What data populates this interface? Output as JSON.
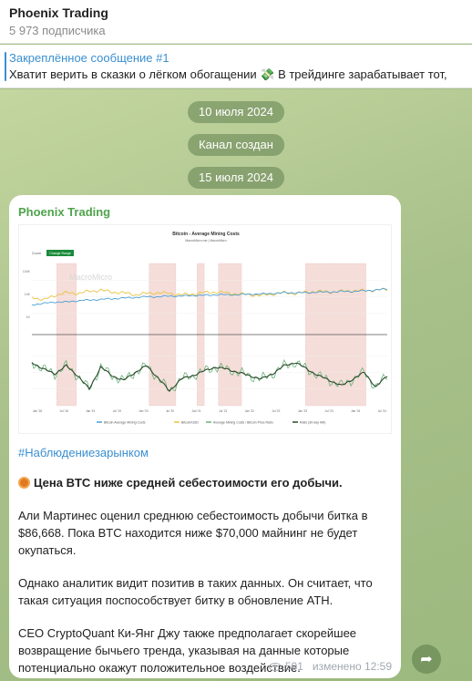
{
  "channel": {
    "title": "Phoenix Trading",
    "subscribers": "5 973 подписчика"
  },
  "pinned": {
    "title": "Закреплённое сообщение #1",
    "text": "Хватит верить в сказки о лёгком обогащении 💸 В трейдинге зарабатывает тот,"
  },
  "service": {
    "date1": "10 июля 2024",
    "created": "Канал создан",
    "date2": "15 июля 2024"
  },
  "message": {
    "author": "Phoenix Trading",
    "hashtag": "#Наблюдениезарынком",
    "headline": "Цена BTC ниже средней себестоимости его добычи.",
    "para1": [
      "Али Мартинес оценил среднюю себестоимость добычи битка в",
      "$86,668. Пока BTC находится ниже $70,000 майнинг не будет",
      "окупаться."
    ],
    "para2": [
      "Однако аналитик видит позитив в таких данных. Он считает, что",
      "такая ситуация поспособствует битку в обновление ATH."
    ],
    "para3": [
      "CEO CryptoQuant Ки-Янг Джу также предполагает скорейшее",
      "возвращение бычьего тренда, указывая на данные которые",
      "потенциально окажут положительное воздействие."
    ],
    "views": "501",
    "edited": "изменено 12:59"
  },
  "chart_data": {
    "type": "line",
    "title": "Bitcoin - Average Mining Costs",
    "subtitle": "MacroMicro.me | MacroMicro",
    "zoom_label": "Zoom",
    "zoom_button": "Change Range",
    "watermark": "MacroMicro",
    "x_ticks": [
      "Jan '18",
      "Jul '18",
      "Jan '19",
      "Jul '19",
      "Jan '20",
      "Jul '20",
      "Jan '21",
      "Jul '21",
      "Jan '22",
      "Jul '22",
      "Jan '23",
      "Jul '23",
      "Jan '24",
      "Jul '24"
    ],
    "upper_y_ticks": [
      "100K",
      "10K",
      "1K"
    ],
    "lower_y_ticks": [
      "",
      "",
      ""
    ],
    "legend": [
      "Bitcoin Average Mining Costs",
      "Bitcoin/USD",
      "Average Mining Costs / Bitcoin Price Ratio",
      "Ratio (30-day MA)"
    ],
    "colors": {
      "mining_cost": "#4a9fd8",
      "btc": "#e8c240",
      "ratio": "#6ab27a",
      "ratio_ma": "#2a4a2a",
      "shade": "#f0c8c0",
      "accent": "#1a8a3a"
    },
    "shaded_ranges": [
      [
        0.07,
        0.125
      ],
      [
        0.33,
        0.405
      ],
      [
        0.465,
        0.485
      ],
      [
        0.525,
        0.59
      ],
      [
        0.77,
        0.94
      ]
    ],
    "series": [
      {
        "name": "Bitcoin Average Mining Costs",
        "values": [
          0.62,
          0.6,
          0.58,
          0.58,
          0.56,
          0.55,
          0.54,
          0.53,
          0.52,
          0.51,
          0.5,
          0.5,
          0.49,
          0.49,
          0.48,
          0.48,
          0.47,
          0.47,
          0.47,
          0.46,
          0.46,
          0.45,
          0.44,
          0.44,
          0.44,
          0.43,
          0.43,
          0.42,
          0.42,
          0.41,
          0.4,
          0.38
        ]
      },
      {
        "name": "Bitcoin/USD",
        "values": [
          0.5,
          0.55,
          0.48,
          0.44,
          0.45,
          0.42,
          0.4,
          0.43,
          0.44,
          0.47,
          0.45,
          0.44,
          0.45,
          0.47,
          0.46,
          0.44,
          0.43,
          0.44,
          0.46,
          0.47,
          0.48,
          0.46,
          0.44,
          0.45,
          0.43,
          0.42,
          0.43,
          0.42,
          0.41,
          0.41,
          0.4,
          0.39
        ]
      },
      {
        "name": "Ratio (30-day MA)",
        "values": [
          0.35,
          0.45,
          0.52,
          0.4,
          0.55,
          0.75,
          0.42,
          0.55,
          0.62,
          0.5,
          0.4,
          0.58,
          0.78,
          0.6,
          0.55,
          0.48,
          0.42,
          0.45,
          0.5,
          0.55,
          0.6,
          0.52,
          0.4,
          0.35,
          0.45,
          0.55,
          0.62,
          0.7,
          0.6,
          0.5,
          0.72,
          0.55
        ]
      }
    ]
  }
}
